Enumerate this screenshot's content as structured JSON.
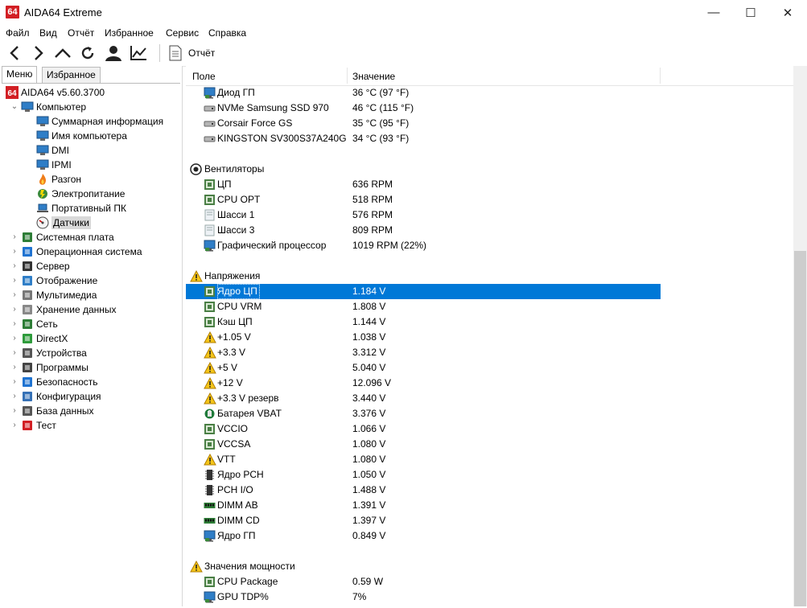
{
  "window": {
    "app_icon_text": "64",
    "title": "AIDA64 Extreme",
    "minimize": "—",
    "maximize": "☐",
    "close": "✕"
  },
  "menu": [
    "Файл",
    "Вид",
    "Отчёт",
    "Избранное",
    "Сервис",
    "Справка"
  ],
  "toolbar": {
    "report_label": "Отчёт"
  },
  "left_panel": {
    "tabs": [
      "Меню",
      "Избранное"
    ],
    "root_label": "AIDA64 v5.60.3700",
    "computer_label": "Компьютер",
    "computer_children": [
      "Суммарная информация",
      "Имя компьютера",
      "DMI",
      "IPMI",
      "Разгон",
      "Электропитание",
      "Портативный ПК",
      "Датчики"
    ],
    "categories": [
      "Системная плата",
      "Операционная система",
      "Сервер",
      "Отображение",
      "Мультимедиа",
      "Хранение данных",
      "Сеть",
      "DirectX",
      "Устройства",
      "Программы",
      "Безопасность",
      "Конфигурация",
      "База данных",
      "Тест"
    ]
  },
  "table": {
    "col_field": "Поле",
    "col_value": "Значение",
    "rows": [
      {
        "type": "item",
        "icon": "monitor",
        "field": "Диод ГП",
        "value": "36 °C  (97 °F)"
      },
      {
        "type": "item",
        "icon": "disk",
        "field": "NVMe Samsung SSD 970",
        "value": "46 °C  (115 °F)"
      },
      {
        "type": "item",
        "icon": "disk",
        "field": "Corsair Force GS",
        "value": "35 °C  (95 °F)"
      },
      {
        "type": "item",
        "icon": "disk",
        "field": "KINGSTON SV300S37A240G",
        "value": "34 °C  (93 °F)"
      },
      {
        "type": "blank"
      },
      {
        "type": "group",
        "icon": "fan",
        "field": "Вентиляторы",
        "value": ""
      },
      {
        "type": "item",
        "icon": "chip",
        "field": "ЦП",
        "value": "636 RPM"
      },
      {
        "type": "item",
        "icon": "chip",
        "field": "CPU OPT",
        "value": "518 RPM"
      },
      {
        "type": "item",
        "icon": "case",
        "field": "Шасси 1",
        "value": "576 RPM"
      },
      {
        "type": "item",
        "icon": "case",
        "field": "Шасси 3",
        "value": "809 RPM"
      },
      {
        "type": "item",
        "icon": "monitor",
        "field": "Графический процессор",
        "value": "1019 RPM  (22%)"
      },
      {
        "type": "blank"
      },
      {
        "type": "group",
        "icon": "warning",
        "field": "Напряжения",
        "value": ""
      },
      {
        "type": "item",
        "icon": "chip",
        "field": "Ядро ЦП",
        "value": "1.184 V",
        "selected": true
      },
      {
        "type": "item",
        "icon": "chip",
        "field": "CPU VRM",
        "value": "1.808 V"
      },
      {
        "type": "item",
        "icon": "chip",
        "field": "Кэш ЦП",
        "value": "1.144 V"
      },
      {
        "type": "item",
        "icon": "warning",
        "field": "+1.05 V",
        "value": "1.038 V"
      },
      {
        "type": "item",
        "icon": "warning",
        "field": "+3.3 V",
        "value": "3.312 V"
      },
      {
        "type": "item",
        "icon": "warning",
        "field": "+5 V",
        "value": "5.040 V"
      },
      {
        "type": "item",
        "icon": "warning",
        "field": "+12 V",
        "value": "12.096 V"
      },
      {
        "type": "item",
        "icon": "warning",
        "field": "+3.3 V резерв",
        "value": "3.440 V"
      },
      {
        "type": "item",
        "icon": "battery",
        "field": "Батарея VBAT",
        "value": "3.376 V"
      },
      {
        "type": "item",
        "icon": "chip",
        "field": "VCCIO",
        "value": "1.066 V"
      },
      {
        "type": "item",
        "icon": "chip",
        "field": "VCCSA",
        "value": "1.080 V"
      },
      {
        "type": "item",
        "icon": "warning",
        "field": "VTT",
        "value": "1.080 V"
      },
      {
        "type": "item",
        "icon": "ic",
        "field": "Ядро PCH",
        "value": "1.050 V"
      },
      {
        "type": "item",
        "icon": "ic",
        "field": "PCH I/O",
        "value": "1.488 V"
      },
      {
        "type": "item",
        "icon": "ram",
        "field": "DIMM AB",
        "value": "1.391 V"
      },
      {
        "type": "item",
        "icon": "ram",
        "field": "DIMM CD",
        "value": "1.397 V"
      },
      {
        "type": "item",
        "icon": "monitor",
        "field": "Ядро ГП",
        "value": "0.849 V"
      },
      {
        "type": "blank"
      },
      {
        "type": "group",
        "icon": "warning",
        "field": "Значения мощности",
        "value": ""
      },
      {
        "type": "item",
        "icon": "chip",
        "field": "CPU Package",
        "value": "0.59 W"
      },
      {
        "type": "item",
        "icon": "monitor",
        "field": "GPU TDP%",
        "value": "7%"
      }
    ]
  }
}
